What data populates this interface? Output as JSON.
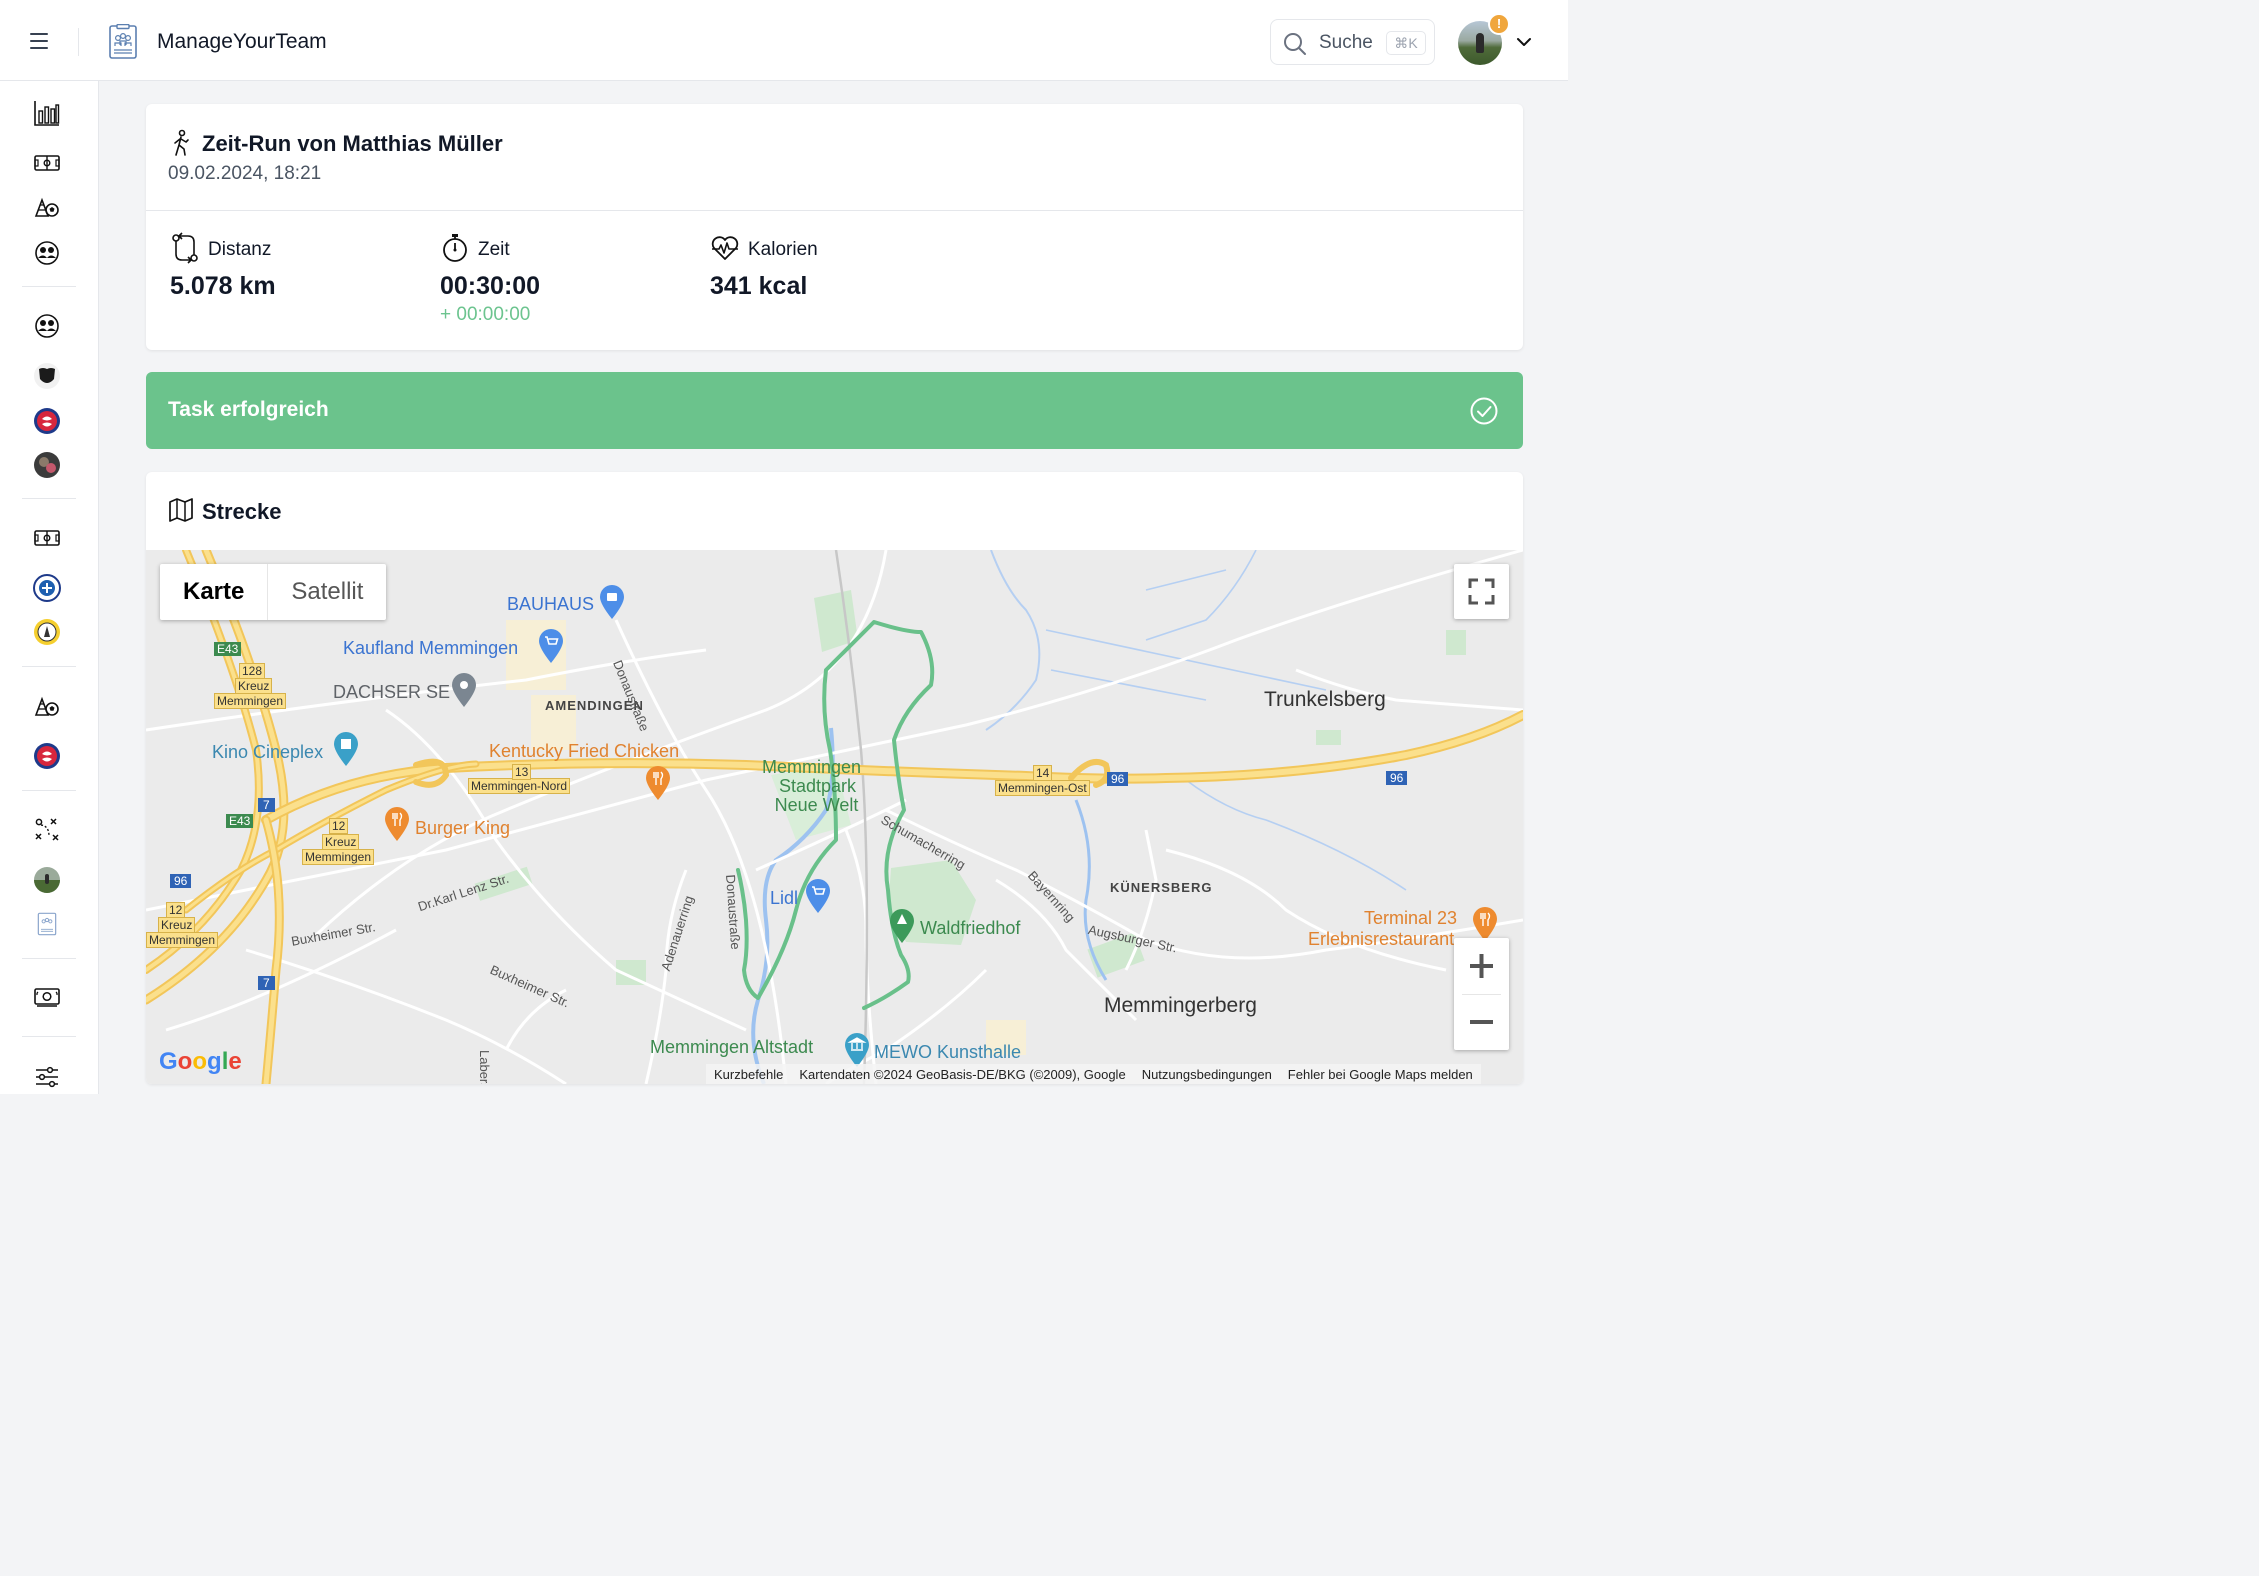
{
  "app": {
    "brand": "ManageYourTeam"
  },
  "search": {
    "label": "Suche",
    "shortcut": "⌘K"
  },
  "user": {
    "badge": "!"
  },
  "sidebar": {
    "items": [
      {
        "icon": "bar-chart-icon"
      },
      {
        "icon": "field-icon"
      },
      {
        "icon": "equipment-icon"
      },
      {
        "icon": "team-icon"
      },
      {
        "icon": "team-icon"
      },
      {
        "icon": "club-crest-icon"
      },
      {
        "icon": "club-crest-icon"
      },
      {
        "icon": "club-crest-icon"
      },
      {
        "icon": "field-icon"
      },
      {
        "icon": "club-crest-icon"
      },
      {
        "icon": "club-crest-icon"
      },
      {
        "icon": "equipment-icon"
      },
      {
        "icon": "club-crest-icon"
      },
      {
        "icon": "tactics-icon"
      },
      {
        "icon": "avatar-icon"
      },
      {
        "icon": "logo-icon"
      },
      {
        "icon": "money-icon"
      },
      {
        "icon": "settings-sliders-icon"
      }
    ]
  },
  "run": {
    "title": "Zeit-Run von Matthias Müller",
    "date": "09.02.2024, 18:21",
    "stats": [
      {
        "label": "Distanz",
        "value": "5.078 km",
        "icon": "route-icon"
      },
      {
        "label": "Zeit",
        "value": "00:30:00",
        "delta": "+ 00:00:00",
        "icon": "stopwatch-icon"
      },
      {
        "label": "Kalorien",
        "value": "341 kcal",
        "icon": "heart-pulse-icon"
      }
    ]
  },
  "status": {
    "text": "Task erfolgreich",
    "color": "#6bc38c"
  },
  "map": {
    "title": "Strecke",
    "type_buttons": [
      "Karte",
      "Satellit"
    ],
    "active_type": "Karte",
    "logo": "Google",
    "attribution": [
      "Kurzbefehle",
      "Kartendaten ©2024 GeoBasis-DE/BKG (©2009), Google",
      "Nutzungsbedingungen",
      "Fehler bei Google Maps melden"
    ],
    "labels": {
      "bauhaus": "BAUHAUS",
      "kaufland": "Kaufland Memmingen",
      "dachser": "DACHSER SE",
      "amendingen": "AMENDINGEN",
      "kino": "Kino Cineplex",
      "kfc": "Kentucky Fried Chicken",
      "memmingen_nord": "Memmingen-Nord",
      "exit13": "13",
      "burger_king": "Burger King",
      "kreuz12": "12",
      "kreuz_label": "Kreuz",
      "kreuz_memmingen": "Memmingen",
      "kreuz128": "128",
      "e43": "E43",
      "a7": "7",
      "a96": "96",
      "stadtpark1": "Memmingen",
      "stadtpark2": "Stadtpark",
      "stadtpark3": "Neue Welt",
      "lidl": "Lidl",
      "waldfriedhof": "Waldfriedhof",
      "memmingen_ost": "Memmingen-Ost",
      "exit14": "14",
      "trunkelsberg": "Trunkelsberg",
      "kunersberg": "KÜNERSBERG",
      "terminal": "Terminal 23",
      "erlebnis": "Erlebnisrestaurant",
      "memmingerberg": "Memmingerberg",
      "altstadt": "Memmingen Altstadt",
      "mewo": "MEWO Kunsthalle",
      "donaustrasse": "Donaustraße",
      "schumacherring": "Schumacherring",
      "bayernring": "Bayernring",
      "augsburger": "Augsburger Str.",
      "karl_lenz": "Dr.Karl Lenz Str.",
      "buxheimer1": "Buxheimer Str.",
      "buxheimer2": "Buxheimer Str.",
      "adenauerring": "Adenauerring",
      "laberstrasse": "Laberstraße",
      "donau2": "Donaustraße"
    }
  }
}
